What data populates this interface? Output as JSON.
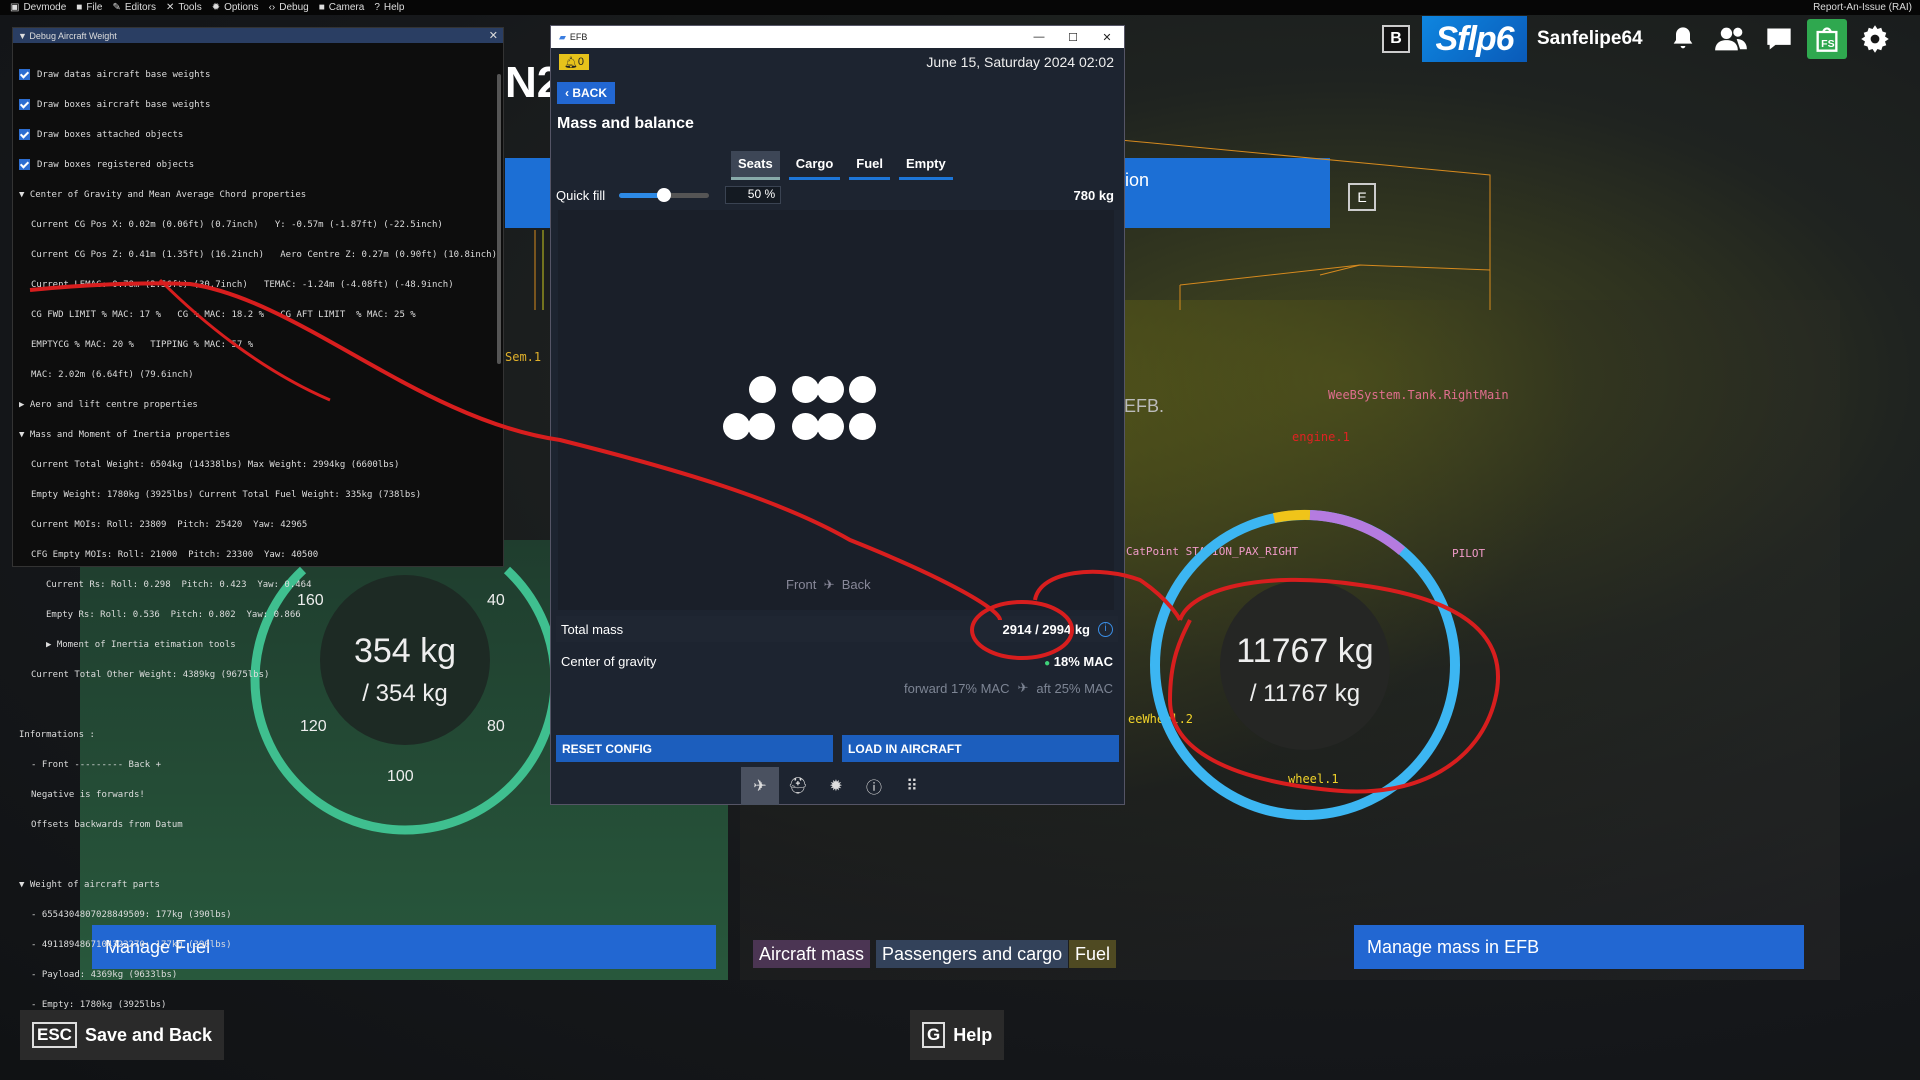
{
  "menubar": {
    "items": [
      {
        "label": "Devmode",
        "icon": "devmode-icon"
      },
      {
        "label": "File",
        "icon": "folder-icon"
      },
      {
        "label": "Editors",
        "icon": "pencil-icon"
      },
      {
        "label": "Tools",
        "icon": "tools-icon"
      },
      {
        "label": "Options",
        "icon": "gear-icon"
      },
      {
        "label": "Debug",
        "icon": "code-icon"
      },
      {
        "label": "Camera",
        "icon": "camera-icon"
      },
      {
        "label": "Help",
        "icon": "help-icon"
      }
    ],
    "report": "Report-An-Issue (RAI)"
  },
  "topbar": {
    "key": "B",
    "brand": "Sflp6",
    "username": "Sanfelipe64"
  },
  "debug": {
    "title": "Debug Aircraft Weight",
    "checkboxes": [
      "Draw datas aircraft base weights",
      "Draw boxes aircraft base weights",
      "Draw boxes attached objects",
      "Draw boxes registered objects"
    ],
    "cg_header": "Center of Gravity and Mean Average Chord properties",
    "cg_lines": [
      "Current CG Pos X: 0.02m (0.06ft) (0.7inch)   Y: -0.57m (-1.87ft) (-22.5inch)",
      "Current CG Pos Z: 0.41m (1.35ft) (16.2inch)   Aero Centre Z: 0.27m (0.90ft) (10.8inch)",
      "Current LEMAC: 0.78m (2.56ft) (30.7inch)   TEMAC: -1.24m (-4.08ft) (-48.9inch)",
      "CG FWD LIMIT % MAC: 17 %   CG % MAC: 18.2 %   CG AFT LIMIT  % MAC: 25 %",
      "EMPTYCG % MAC: 20 %   TIPPING % MAC: 57 %",
      "MAC: 2.02m (6.64ft) (79.6inch)"
    ],
    "aero_header": "Aero and lift centre properties",
    "mass_header": "Mass and Moment of Inertia properties",
    "mass_lines": [
      "Current Total Weight: 6504kg (14338lbs) Max Weight: 2994kg (6600lbs)",
      "Empty Weight: 1780kg (3925lbs) Current Total Fuel Weight: 335kg (738lbs)",
      "Current MOIs: Roll: 23809  Pitch: 25420  Yaw: 42965",
      "CFG Empty MOIs: Roll: 21000  Pitch: 23300  Yaw: 40500"
    ],
    "rs_lines": [
      "Current Rs: Roll: 0.298  Pitch: 0.423  Yaw: 0.464",
      "Empty Rs: Roll: 0.536  Pitch: 0.802  Yaw: 0.866"
    ],
    "moi_tools": "Moment of Inertia etimation tools",
    "other_weight": "Current Total Other Weight: 4389kg (9675lbs)",
    "info_header": "Informations :",
    "info_lines": [
      "- Front --------- Back +",
      "Negative is forwards!",
      "Offsets backwards from Datum"
    ],
    "parts_header": "Weight of aircraft parts",
    "parts_lines": [
      "- 6554304807028849509: 177kg (390lbs)",
      "- 4911894867104322270: 177kg (390lbs)",
      "- Payload: 4369kg (9633lbs)",
      "- Empty: 1780kg (3925lbs)"
    ]
  },
  "scene": {
    "big_label": "N2",
    "banner": "ion",
    "efb_text": "EFB.",
    "key_e": "E",
    "debug_texts": {
      "tank": "WeeBSystem.Tank.RightMain",
      "engine": "engine.1",
      "wheel2": "eeWheel.2",
      "wheel1": "wheel.1",
      "sem": "Sem.1",
      "station": "CatPoint  STATION_PAX_RIGHT",
      "pilot": "PILOT"
    }
  },
  "left_gauge": {
    "value": "354 kg",
    "max": "/ 354 kg",
    "ticks": [
      "160",
      "40",
      "120",
      "80",
      "100"
    ],
    "color": "#3fbf8f"
  },
  "right_gauge": {
    "value": "11767 kg",
    "max": "/ 11767 kg",
    "color": "#3cb6f2"
  },
  "buttons": {
    "manage_fuel": "Manage Fuel",
    "manage_mass": "Manage mass in EFB"
  },
  "tags": [
    {
      "label": "Aircraft mass",
      "color": "#4b3553"
    },
    {
      "label": "Passengers and cargo",
      "color": "#33425a"
    },
    {
      "label": "Fuel",
      "color": "#4f4a22"
    }
  ],
  "bottom": {
    "save_key": "ESC",
    "save_label": "Save and Back",
    "help_key": "G",
    "help_label": "Help"
  },
  "efb": {
    "window_title": "EFB",
    "alert_count": "0",
    "date": "June 15, Saturday 2024 02:02",
    "back": "BACK",
    "page_title": "Mass and balance",
    "tabs": [
      "Seats",
      "Cargo",
      "Fuel",
      "Empty"
    ],
    "active_tab": "Seats",
    "quick_fill": {
      "label": "Quick fill",
      "percent": "50 %",
      "value": 0.5,
      "mass": "780 kg"
    },
    "orientation": {
      "front": "Front",
      "back": "Back"
    },
    "total_mass": {
      "label": "Total mass",
      "value": "2914 / 2994 kg"
    },
    "cg": {
      "label": "Center of gravity",
      "value": "18% MAC",
      "forward": "forward 17% MAC",
      "aft": "aft 25% MAC"
    },
    "actions": {
      "reset": "RESET CONFIG",
      "load": "LOAD IN AIRCRAFT"
    }
  }
}
